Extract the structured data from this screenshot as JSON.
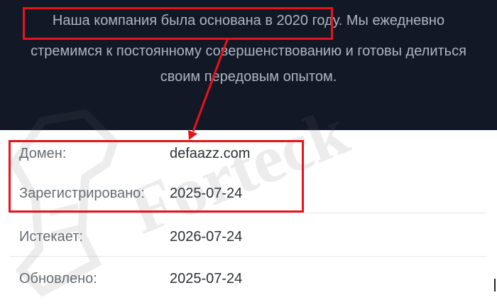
{
  "hero": {
    "line1": "Наша компания была основана в 2020 году. Мы ежедневно",
    "line2": "стремимся к постоянному совершенствованию и готовы делиться",
    "line3": "своим передовым опытом."
  },
  "whois": {
    "rows": [
      {
        "label": "Домен:",
        "value": "defaazz.com"
      },
      {
        "label": "Зарегистрировано:",
        "value": "2025-07-24"
      },
      {
        "label": "Истекает:",
        "value": "2026-07-24"
      },
      {
        "label": "Обновлено:",
        "value": "2025-07-24"
      }
    ]
  },
  "watermark": {
    "text": "Forteck"
  },
  "colors": {
    "annotation": "#e8121b",
    "hero_bg": "#121826",
    "hero_text": "#aeb6c2"
  }
}
